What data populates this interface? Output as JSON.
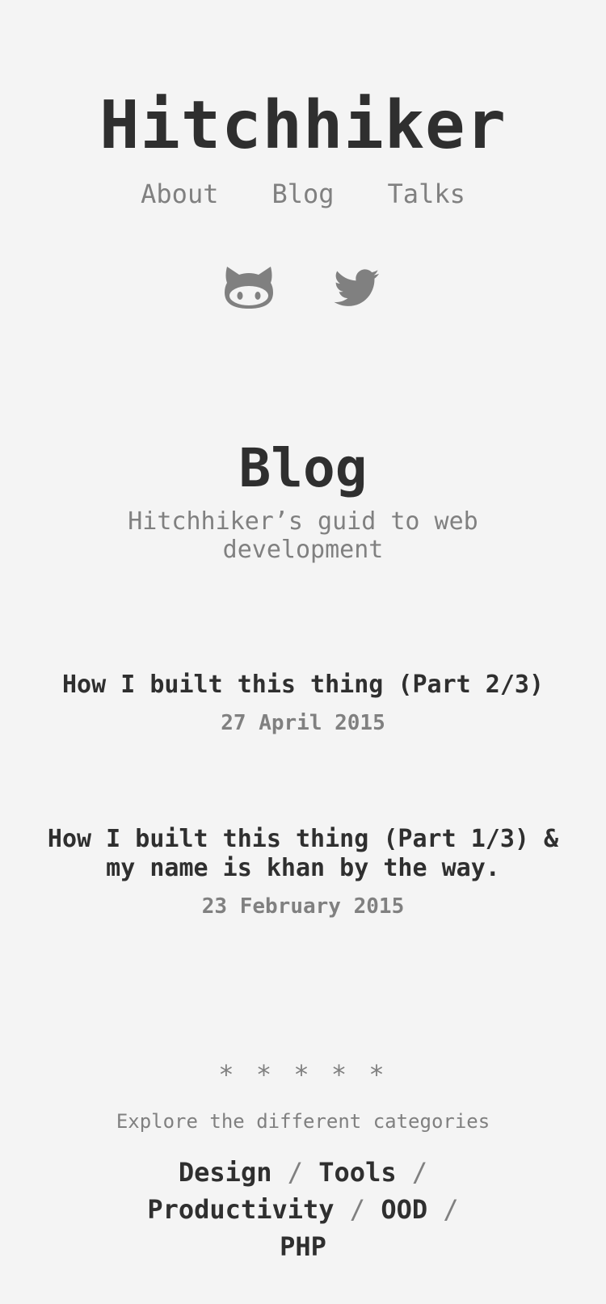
{
  "header": {
    "site_title": "Hitchhiker",
    "nav": [
      {
        "label": "About"
      },
      {
        "label": "Blog"
      },
      {
        "label": "Talks"
      }
    ],
    "social": [
      {
        "icon": "github-icon"
      },
      {
        "icon": "twitter-icon"
      }
    ]
  },
  "blog": {
    "heading": "Blog",
    "subtitle": "Hitchhiker’s guid to web development"
  },
  "posts": [
    {
      "title": "How I built this thing (Part 2/3)",
      "date": "27 April 2015"
    },
    {
      "title": "How I built this thing (Part 1/3) & my name is khan by the way.",
      "date": "23 February 2015"
    }
  ],
  "footer": {
    "stars": "* * * * *",
    "explore_text": "Explore the different categories",
    "separator": "/",
    "categories": [
      "Design",
      "Tools",
      "Productivity",
      "OOD",
      "PHP"
    ]
  },
  "colors": {
    "background": "#f4f4f4",
    "text": "#2f2f2f",
    "muted": "#808080"
  }
}
